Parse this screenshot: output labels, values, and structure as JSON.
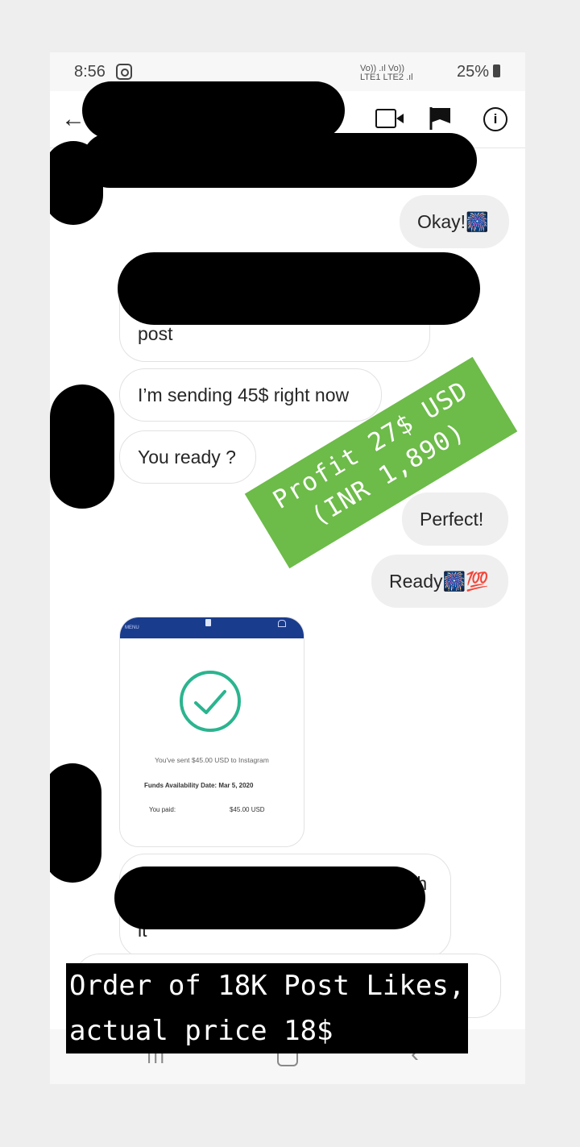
{
  "status_bar": {
    "time": "8:56",
    "signal_top": "Vo)) .ıl Vo))",
    "signal_bottom": "LTE1  LTE2 .ıl",
    "battery": "25%"
  },
  "header": {
    "back_icon": "arrow-left-icon",
    "video_icon": "video-camera-icon",
    "flag_icon": "flag-icon",
    "info_icon": "info-icon",
    "info_glyph": "i",
    "back_glyph": "←"
  },
  "messages": [
    {
      "side": "out",
      "text": "Okay!🎆"
    },
    {
      "side": "in",
      "text": "post"
    },
    {
      "side": "in",
      "text": "I’m sending 45$ right now"
    },
    {
      "side": "in",
      "text": "You ready ?"
    },
    {
      "side": "out",
      "text": "Perfect!"
    },
    {
      "side": "out",
      "text": "Ready🎆💯"
    },
    {
      "side": "in",
      "text": "it",
      "fragment": "th"
    }
  ],
  "payment_card": {
    "menu": "MENU",
    "sent": "You've sent $45.00 USD to Instagram",
    "funds": "Funds Availability Date: Mar 5, 2020",
    "paid_label": "You paid:",
    "paid_value": "$45.00 USD"
  },
  "overlay": {
    "profit_line1": "Profit 27$ USD",
    "profit_line2": "(INR 1,890)",
    "order_line1": "Order of 18K Post Likes,",
    "order_line2": "actual price 18$"
  },
  "nav": {
    "menu_glyph": "III",
    "back_glyph": "‹"
  },
  "colors": {
    "stamp": "#6dbb49",
    "paypal": "#1a3c8c",
    "check": "#2bb48f"
  }
}
